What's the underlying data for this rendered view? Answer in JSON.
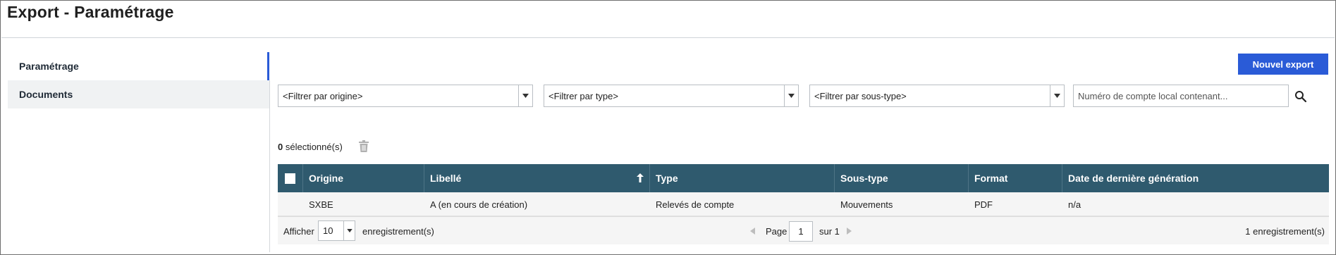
{
  "page": {
    "title": "Export - Paramétrage"
  },
  "sidebar": {
    "items": [
      {
        "label": "Paramétrage",
        "active": true
      },
      {
        "label": "Documents",
        "active": false
      }
    ]
  },
  "toolbar": {
    "new_export_label": "Nouvel export"
  },
  "filters": {
    "origine": "<Filtrer par origine>",
    "type": "<Filtrer par type>",
    "sous_type": "<Filtrer par sous-type>",
    "search_placeholder": "Numéro de compte local contenant..."
  },
  "selection": {
    "count": "0",
    "label": " sélectionné(s)"
  },
  "table": {
    "headers": {
      "origine": "Origine",
      "libelle": "Libellé",
      "type": "Type",
      "sous_type": "Sous-type",
      "format": "Format",
      "date": "Date de dernière génération"
    },
    "sort": {
      "column": "libelle",
      "direction": "ascending"
    },
    "rows": [
      {
        "origine": "SXBE",
        "libelle": "A (en cours de création)",
        "type": "Relevés de compte",
        "sous_type": "Mouvements",
        "format": "PDF",
        "date": "n/a"
      }
    ]
  },
  "footer": {
    "afficher": "Afficher",
    "page_size": "10",
    "enregistrements": "enregistrement(s)",
    "page_label": "Page",
    "page_value": "1",
    "sur": "sur 1",
    "total": "1 enregistrement(s)"
  },
  "colors": {
    "accent": "#2a5bd7",
    "table_header": "#2f5a6e",
    "sidebar_inactive": "#f0f2f3"
  },
  "icons": [
    "chevron-down-icon",
    "search-icon",
    "trash-icon",
    "sort-ascending-icon",
    "chevron-left-icon",
    "chevron-right-icon",
    "checkbox-icon"
  ]
}
